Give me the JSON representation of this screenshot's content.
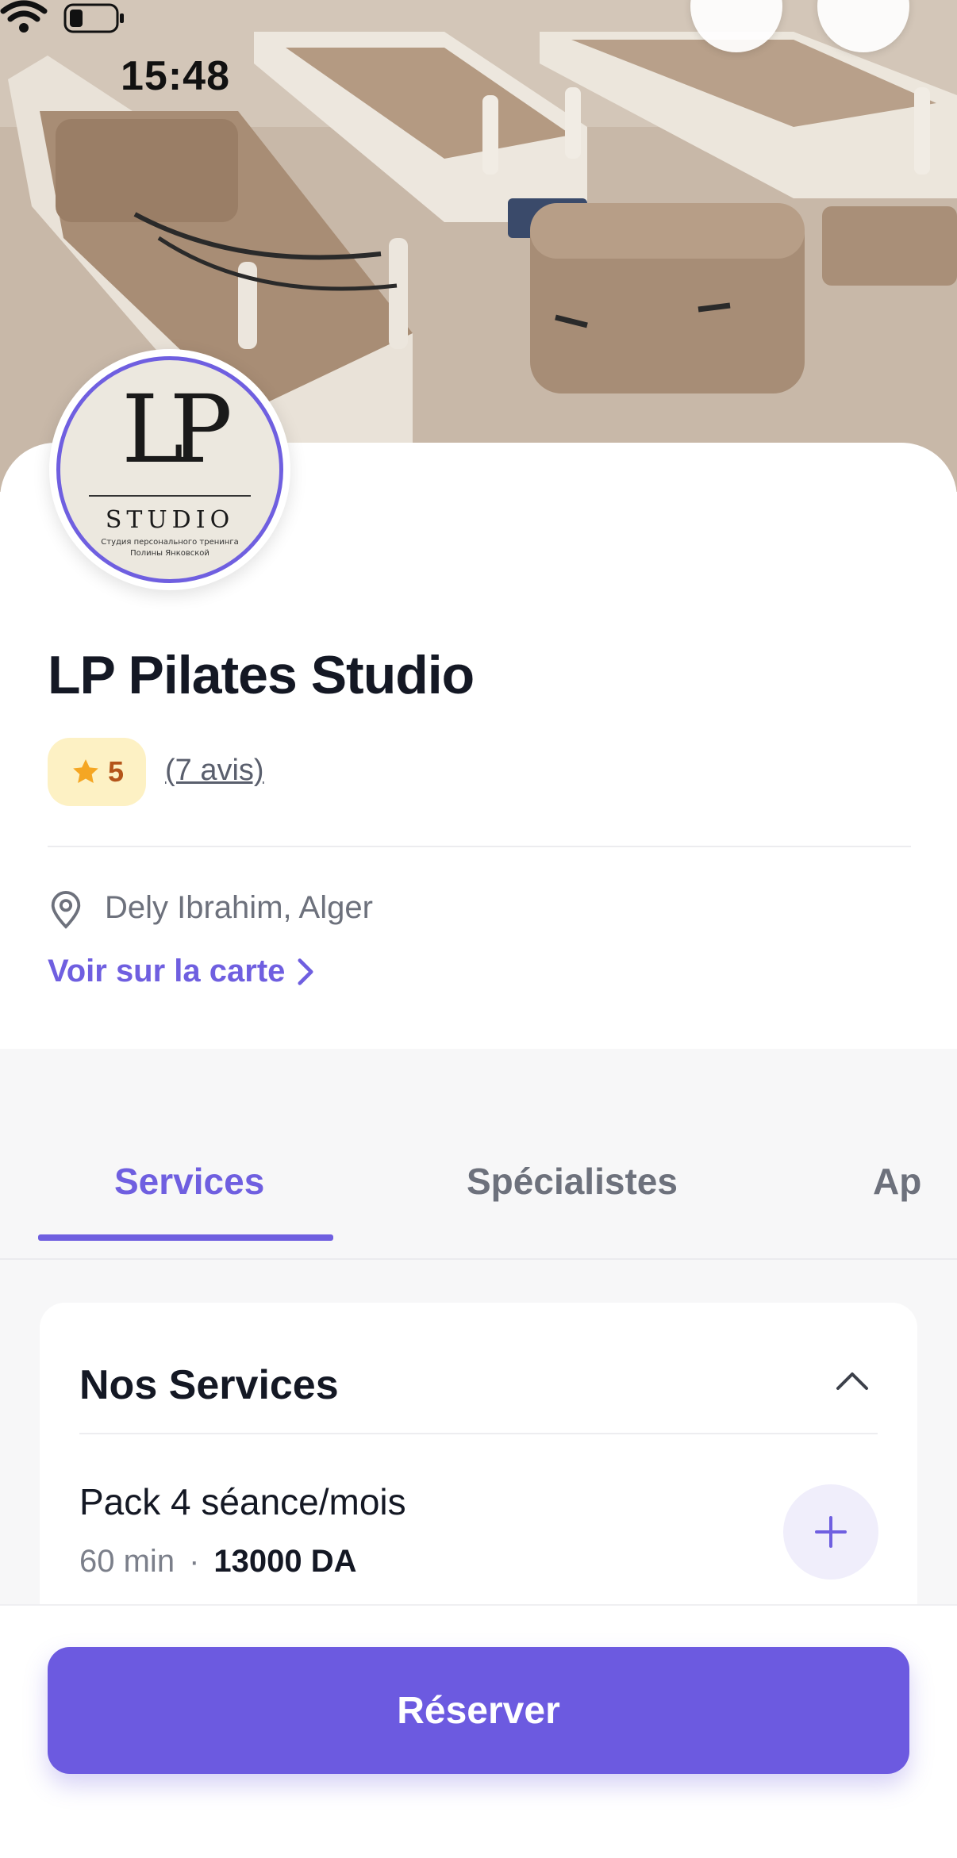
{
  "status_bar": {
    "time": "15:48"
  },
  "hero": {
    "image_description_icon": "pilates-reformer-photo"
  },
  "logo": {
    "monogram": "LP",
    "word": "STUDIO",
    "subtitle_line1": "Студия персонального тренинга",
    "subtitle_line2": "Полины Янковской"
  },
  "studio": {
    "name": "LP Pilates Studio",
    "rating": "5",
    "reviews": "(7 avis)",
    "location": "Dely Ibrahim, Alger",
    "map_link": "Voir sur la carte"
  },
  "tabs": [
    {
      "label": "Services",
      "active": true
    },
    {
      "label": "Spécialistes",
      "active": false
    },
    {
      "label": "Ap",
      "active": false
    }
  ],
  "services": {
    "title": "Nos Services",
    "items": [
      {
        "name": "Pack 4 séance/mois",
        "duration": "60 min",
        "separator": "·",
        "price": "13000 DA"
      }
    ]
  },
  "footer": {
    "reserve_label": "Réserver"
  },
  "colors": {
    "accent": "#6c5ae0",
    "rating_bg": "#fdf1c4",
    "rating_text": "#b4551a",
    "star": "#f5a623"
  }
}
